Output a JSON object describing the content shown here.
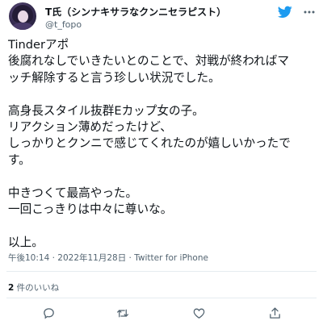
{
  "user": {
    "display_name": "T氏（シンナキサラなクンニセラピスト）",
    "handle": "@t_fopo"
  },
  "tweet": {
    "lines": [
      "Tinderアポ",
      "後腐れなしでいきたいとのことで、対戦が終わればマ",
      "ッチ解除すると言う珍しい状況でした。",
      "",
      "高身長スタイル抜群Eカップ女の子。",
      "リアクション薄めだったけど、",
      "しっかりとクンニで感じてくれたのが嬉しいかったで",
      "す。",
      "",
      "中きつくて最高やった。",
      "一回こっきりは中々に尊いな。",
      "",
      "以上。"
    ]
  },
  "meta": {
    "timestamp": "午後10:14 · 2022年11月28日 · Twitter for iPhone"
  },
  "stats": {
    "likes_count": "2",
    "likes_label": " 件のいいね"
  },
  "icons": {
    "logo": "twitter-bird-icon",
    "more": "more-dots-icon",
    "reply": "reply-icon",
    "retweet": "retweet-icon",
    "like": "like-heart-icon",
    "share": "share-icon"
  },
  "colors": {
    "text": "#0f1419",
    "secondary": "#536471",
    "accent": "#1d9bf0"
  }
}
